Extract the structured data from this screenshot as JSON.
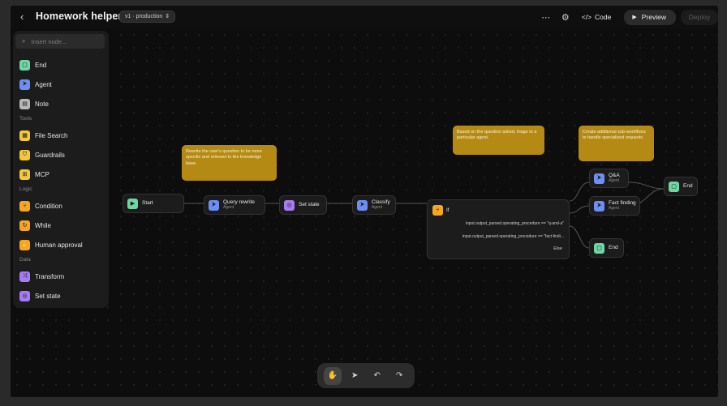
{
  "header": {
    "title": "Homework helper",
    "version": "v1 · production",
    "code_label": "Code",
    "preview_label": "Preview",
    "deploy_label": "Deploy"
  },
  "sidebar": {
    "search_placeholder": "Insert node...",
    "top_items": [
      {
        "label": "End",
        "icon": "end-icon",
        "color": "#6fd6a4"
      },
      {
        "label": "Agent",
        "icon": "agent-icon",
        "color": "#6d8ef5"
      },
      {
        "label": "Note",
        "icon": "note-icon",
        "color": "#b8b8b8"
      }
    ],
    "sections": [
      {
        "title": "Tools",
        "items": [
          {
            "label": "File Search",
            "icon": "file-search-icon",
            "color": "#f3c83a"
          },
          {
            "label": "Guardrails",
            "icon": "guardrails-icon",
            "color": "#f3c83a"
          },
          {
            "label": "MCP",
            "icon": "mcp-icon",
            "color": "#f3c83a"
          }
        ]
      },
      {
        "title": "Logic",
        "items": [
          {
            "label": "Condition",
            "icon": "condition-icon",
            "color": "#f5a623"
          },
          {
            "label": "While",
            "icon": "while-icon",
            "color": "#f5a623"
          },
          {
            "label": "Human approval",
            "icon": "human-approval-icon",
            "color": "#f5a623"
          }
        ]
      },
      {
        "title": "Data",
        "items": [
          {
            "label": "Transform",
            "icon": "transform-icon",
            "color": "#a77bf3"
          },
          {
            "label": "Set state",
            "icon": "set-state-icon",
            "color": "#a77bf3"
          }
        ]
      }
    ]
  },
  "nodes": {
    "start": {
      "label": "Start"
    },
    "query_rewrite": {
      "label": "Query rewrite",
      "sub": "Agent"
    },
    "set_state": {
      "label": "Set state"
    },
    "classify": {
      "label": "Classify",
      "sub": "Agent"
    },
    "if": {
      "label": "If",
      "conditions": [
        "input.output_parsed.operating_procedure == \"q-and-a\"",
        "input.output_parsed.operating_procedure == \"fact-findi..."
      ],
      "else_label": "Else"
    },
    "qa": {
      "label": "Q&A",
      "sub": "Agent"
    },
    "fact_finding": {
      "label": "Fact finding",
      "sub": "Agent"
    },
    "end_right": {
      "label": "End"
    },
    "end_bottom": {
      "label": "End"
    }
  },
  "notes": {
    "rewrite": "Rewrite the user's question to be more specific and relevant to the knowledge base.",
    "triage": "Based on the question asked, triage to a particular agent.",
    "subworkflows": "Create additional sub-workflows to handle specialized requests."
  },
  "toolbar": {
    "tools": [
      "hand-icon",
      "pointer-icon",
      "undo-icon",
      "redo-icon"
    ],
    "active": "hand-icon"
  },
  "colors": {
    "start": "#6fd6a4",
    "agent": "#6d8ef5",
    "set_state": "#a77bf3",
    "condition": "#f5a623",
    "end": "#6fd6a4",
    "note": "#b48a14"
  }
}
